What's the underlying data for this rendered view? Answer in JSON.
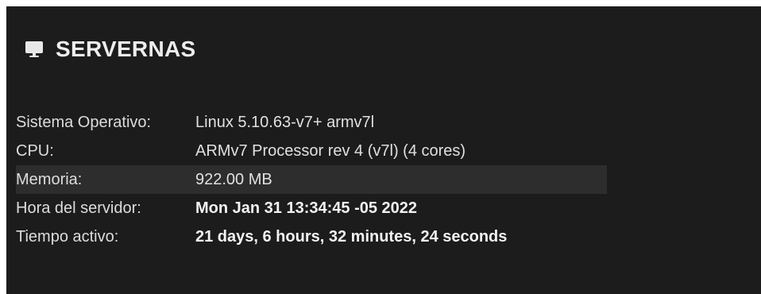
{
  "panel": {
    "title": "SERVERNAS",
    "icon": "monitor-icon"
  },
  "info": {
    "rows": [
      {
        "label": "Sistema Operativo:",
        "value": "Linux 5.10.63-v7+ armv7l"
      },
      {
        "label": "CPU:",
        "value": "ARMv7 Processor rev 4 (v7l) (4 cores)"
      },
      {
        "label": "Memoria:",
        "value": "922.00 MB"
      },
      {
        "label": "Hora del servidor:",
        "value": "Mon Jan 31 13:34:45 -05 2022"
      },
      {
        "label": "Tiempo activo:",
        "value": "21 days, 6 hours, 32 minutes, 24 seconds"
      }
    ]
  },
  "colors": {
    "panel_background": "#1c1c1c",
    "highlight_row": "#2d2d2d",
    "text": "#e0e0e0"
  }
}
